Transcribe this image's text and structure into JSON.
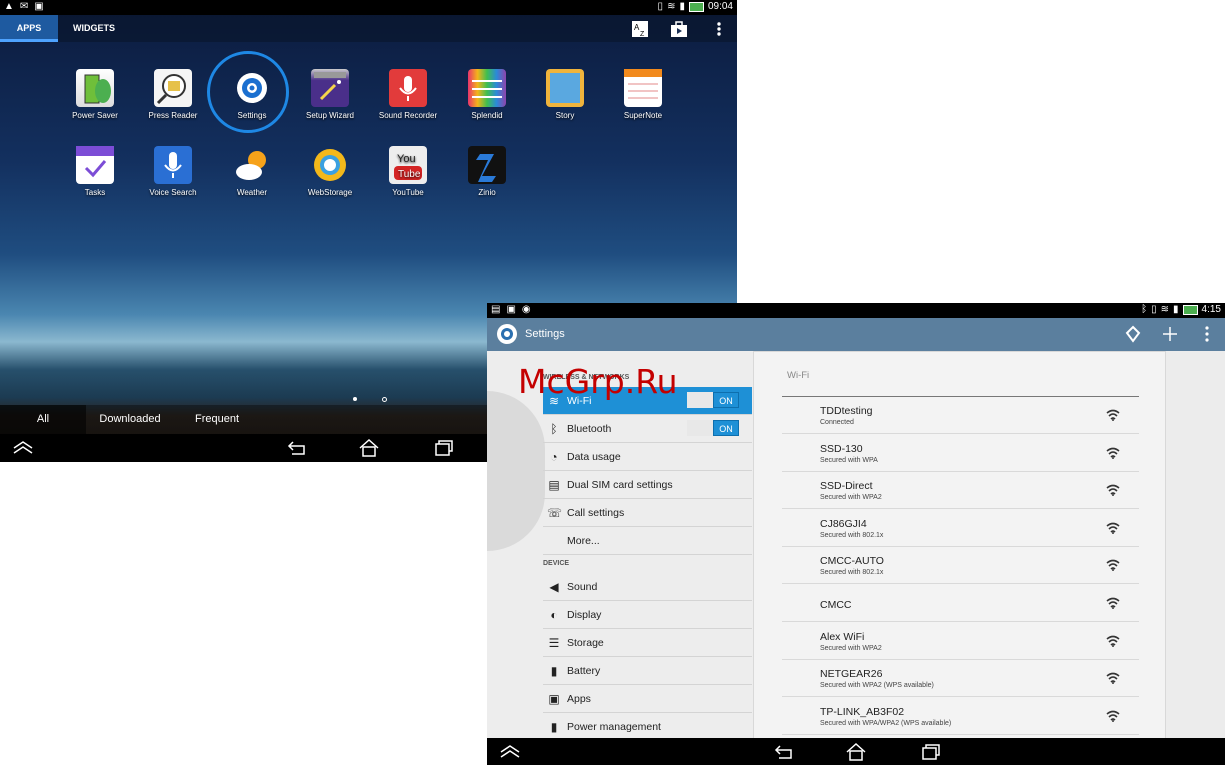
{
  "screen1": {
    "status": {
      "time": "09:04"
    },
    "tabs": [
      "APPS",
      "WIDGETS"
    ],
    "actions": [
      "sort-az-icon",
      "store-icon",
      "overflow-menu-icon"
    ],
    "apps_row1": [
      "Power Saver",
      "Press Reader",
      "Settings",
      "Setup Wizard",
      "Sound Recorder",
      "Splendid",
      "Story",
      "SuperNote"
    ],
    "apps_row2": [
      "Tasks",
      "Voice Search",
      "Weather",
      "WebStorage",
      "YouTube",
      "Zinio"
    ],
    "bottom_tabs": [
      "All",
      "Downloaded",
      "Frequent"
    ]
  },
  "screen2": {
    "status": {
      "time": "4:15"
    },
    "title": "Settings",
    "section_wireless": "WIRELESS & NETWORKS",
    "section_device": "DEVICE",
    "toggle_on": "ON",
    "items": {
      "wifi": "Wi-Fi",
      "bluetooth": "Bluetooth",
      "data_usage": "Data usage",
      "dual_sim": "Dual SIM card settings",
      "call": "Call settings",
      "more": "More...",
      "sound": "Sound",
      "display": "Display",
      "storage": "Storage",
      "battery": "Battery",
      "apps": "Apps",
      "power": "Power management"
    },
    "wifi_header": "Wi-Fi",
    "networks": [
      {
        "ssid": "TDDtesting",
        "status": "Connected"
      },
      {
        "ssid": "SSD-130",
        "status": "Secured with WPA"
      },
      {
        "ssid": "SSD-Direct",
        "status": "Secured with WPA2"
      },
      {
        "ssid": "CJ86GJI4",
        "status": "Secured with 802.1x"
      },
      {
        "ssid": "CMCC-AUTO",
        "status": "Secured with 802.1x"
      },
      {
        "ssid": "CMCC",
        "status": ""
      },
      {
        "ssid": "Alex WiFi",
        "status": "Secured with WPA2"
      },
      {
        "ssid": "NETGEAR26",
        "status": "Secured with WPA2 (WPS available)"
      },
      {
        "ssid": "TP-LINK_AB3F02",
        "status": "Secured with WPA/WPA2 (WPS available)"
      }
    ]
  },
  "watermark": "McGrp.Ru"
}
